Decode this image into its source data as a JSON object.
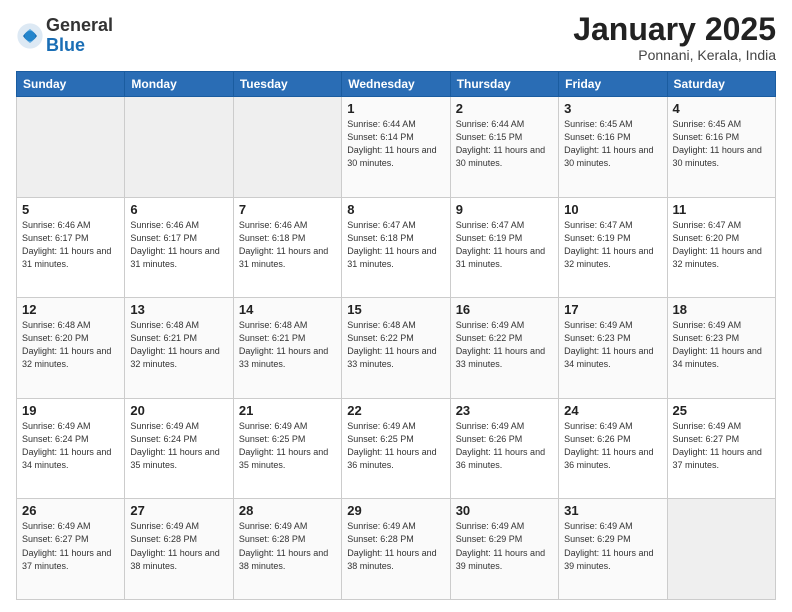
{
  "header": {
    "logo_general": "General",
    "logo_blue": "Blue",
    "month_title": "January 2025",
    "location": "Ponnani, Kerala, India"
  },
  "weekdays": [
    "Sunday",
    "Monday",
    "Tuesday",
    "Wednesday",
    "Thursday",
    "Friday",
    "Saturday"
  ],
  "weeks": [
    [
      {
        "day": "",
        "info": ""
      },
      {
        "day": "",
        "info": ""
      },
      {
        "day": "",
        "info": ""
      },
      {
        "day": "1",
        "info": "Sunrise: 6:44 AM\nSunset: 6:14 PM\nDaylight: 11 hours\nand 30 minutes."
      },
      {
        "day": "2",
        "info": "Sunrise: 6:44 AM\nSunset: 6:15 PM\nDaylight: 11 hours\nand 30 minutes."
      },
      {
        "day": "3",
        "info": "Sunrise: 6:45 AM\nSunset: 6:16 PM\nDaylight: 11 hours\nand 30 minutes."
      },
      {
        "day": "4",
        "info": "Sunrise: 6:45 AM\nSunset: 6:16 PM\nDaylight: 11 hours\nand 30 minutes."
      }
    ],
    [
      {
        "day": "5",
        "info": "Sunrise: 6:46 AM\nSunset: 6:17 PM\nDaylight: 11 hours\nand 31 minutes."
      },
      {
        "day": "6",
        "info": "Sunrise: 6:46 AM\nSunset: 6:17 PM\nDaylight: 11 hours\nand 31 minutes."
      },
      {
        "day": "7",
        "info": "Sunrise: 6:46 AM\nSunset: 6:18 PM\nDaylight: 11 hours\nand 31 minutes."
      },
      {
        "day": "8",
        "info": "Sunrise: 6:47 AM\nSunset: 6:18 PM\nDaylight: 11 hours\nand 31 minutes."
      },
      {
        "day": "9",
        "info": "Sunrise: 6:47 AM\nSunset: 6:19 PM\nDaylight: 11 hours\nand 31 minutes."
      },
      {
        "day": "10",
        "info": "Sunrise: 6:47 AM\nSunset: 6:19 PM\nDaylight: 11 hours\nand 32 minutes."
      },
      {
        "day": "11",
        "info": "Sunrise: 6:47 AM\nSunset: 6:20 PM\nDaylight: 11 hours\nand 32 minutes."
      }
    ],
    [
      {
        "day": "12",
        "info": "Sunrise: 6:48 AM\nSunset: 6:20 PM\nDaylight: 11 hours\nand 32 minutes."
      },
      {
        "day": "13",
        "info": "Sunrise: 6:48 AM\nSunset: 6:21 PM\nDaylight: 11 hours\nand 32 minutes."
      },
      {
        "day": "14",
        "info": "Sunrise: 6:48 AM\nSunset: 6:21 PM\nDaylight: 11 hours\nand 33 minutes."
      },
      {
        "day": "15",
        "info": "Sunrise: 6:48 AM\nSunset: 6:22 PM\nDaylight: 11 hours\nand 33 minutes."
      },
      {
        "day": "16",
        "info": "Sunrise: 6:49 AM\nSunset: 6:22 PM\nDaylight: 11 hours\nand 33 minutes."
      },
      {
        "day": "17",
        "info": "Sunrise: 6:49 AM\nSunset: 6:23 PM\nDaylight: 11 hours\nand 34 minutes."
      },
      {
        "day": "18",
        "info": "Sunrise: 6:49 AM\nSunset: 6:23 PM\nDaylight: 11 hours\nand 34 minutes."
      }
    ],
    [
      {
        "day": "19",
        "info": "Sunrise: 6:49 AM\nSunset: 6:24 PM\nDaylight: 11 hours\nand 34 minutes."
      },
      {
        "day": "20",
        "info": "Sunrise: 6:49 AM\nSunset: 6:24 PM\nDaylight: 11 hours\nand 35 minutes."
      },
      {
        "day": "21",
        "info": "Sunrise: 6:49 AM\nSunset: 6:25 PM\nDaylight: 11 hours\nand 35 minutes."
      },
      {
        "day": "22",
        "info": "Sunrise: 6:49 AM\nSunset: 6:25 PM\nDaylight: 11 hours\nand 36 minutes."
      },
      {
        "day": "23",
        "info": "Sunrise: 6:49 AM\nSunset: 6:26 PM\nDaylight: 11 hours\nand 36 minutes."
      },
      {
        "day": "24",
        "info": "Sunrise: 6:49 AM\nSunset: 6:26 PM\nDaylight: 11 hours\nand 36 minutes."
      },
      {
        "day": "25",
        "info": "Sunrise: 6:49 AM\nSunset: 6:27 PM\nDaylight: 11 hours\nand 37 minutes."
      }
    ],
    [
      {
        "day": "26",
        "info": "Sunrise: 6:49 AM\nSunset: 6:27 PM\nDaylight: 11 hours\nand 37 minutes."
      },
      {
        "day": "27",
        "info": "Sunrise: 6:49 AM\nSunset: 6:28 PM\nDaylight: 11 hours\nand 38 minutes."
      },
      {
        "day": "28",
        "info": "Sunrise: 6:49 AM\nSunset: 6:28 PM\nDaylight: 11 hours\nand 38 minutes."
      },
      {
        "day": "29",
        "info": "Sunrise: 6:49 AM\nSunset: 6:28 PM\nDaylight: 11 hours\nand 38 minutes."
      },
      {
        "day": "30",
        "info": "Sunrise: 6:49 AM\nSunset: 6:29 PM\nDaylight: 11 hours\nand 39 minutes."
      },
      {
        "day": "31",
        "info": "Sunrise: 6:49 AM\nSunset: 6:29 PM\nDaylight: 11 hours\nand 39 minutes."
      },
      {
        "day": "",
        "info": ""
      }
    ]
  ]
}
